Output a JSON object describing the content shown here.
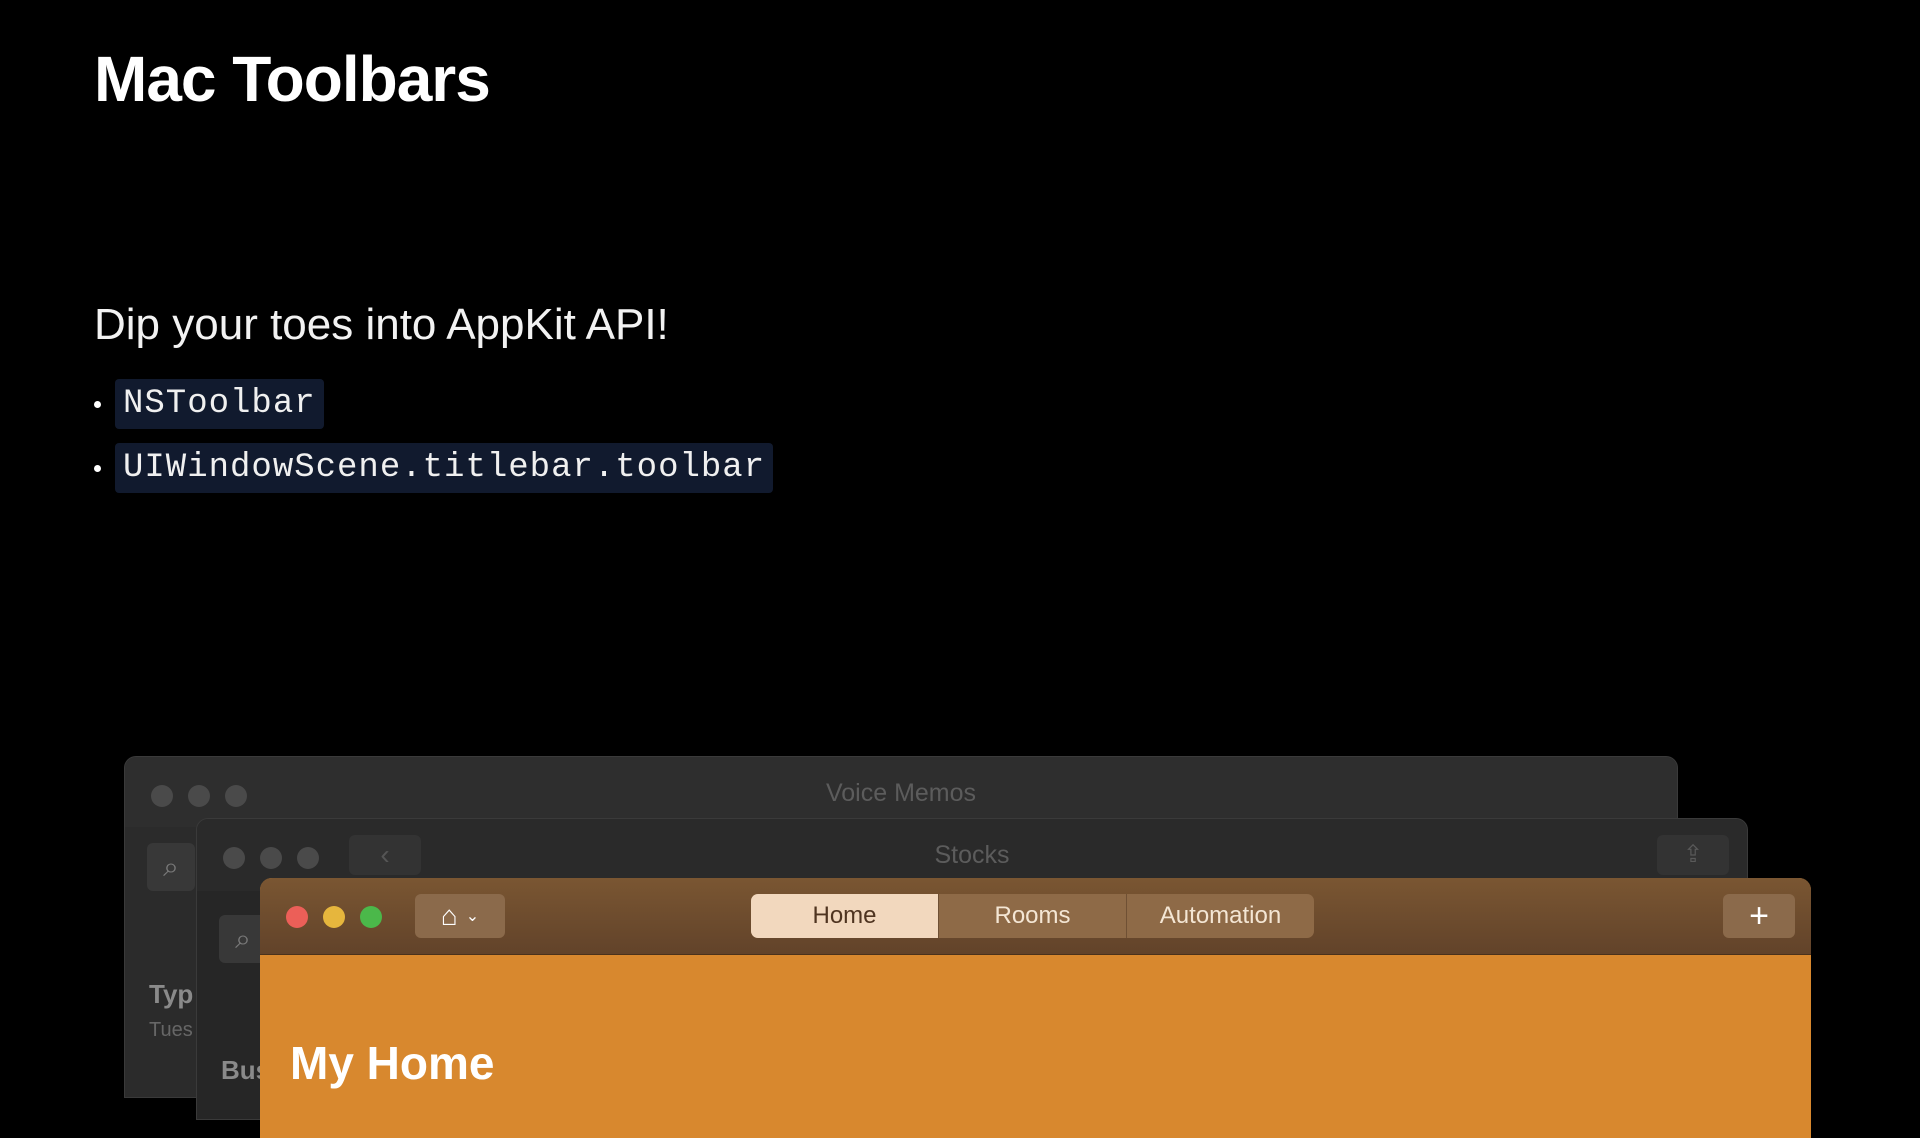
{
  "slide": {
    "title": "Mac Toolbars",
    "subtitle": "Dip your toes into AppKit API!",
    "bullets": [
      "NSToolbar",
      "UIWindowScene.titlebar.toolbar"
    ]
  },
  "windows": {
    "voice_memos": {
      "title": "Voice Memos",
      "search_icon": "search-icon",
      "section_label": "Typ",
      "date_fragment": "Tues"
    },
    "stocks": {
      "title": "Stocks",
      "back_icon": "‹",
      "share_icon": "⇪",
      "section_label": "Bus"
    },
    "home": {
      "home_icon": "⌂",
      "chevron_icon": "⌄",
      "tabs": [
        {
          "label": "Home",
          "selected": true
        },
        {
          "label": "Rooms",
          "selected": false
        },
        {
          "label": "Automation",
          "selected": false
        }
      ],
      "add_label": "+",
      "main_title": "My Home"
    }
  },
  "colors": {
    "background": "#000000",
    "code_background": "#111a2e",
    "home_accent": "#d8882e"
  }
}
